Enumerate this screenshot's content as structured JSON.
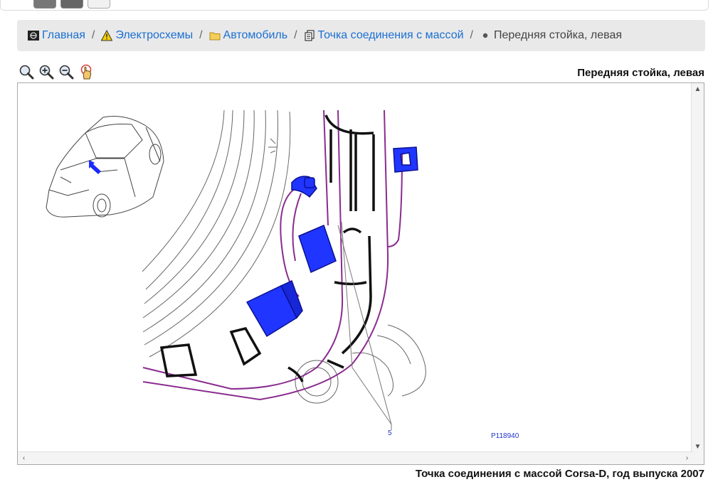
{
  "breadcrumb": {
    "items": [
      {
        "label": "Главная",
        "icon": "car-logo-icon"
      },
      {
        "label": "Электросхемы",
        "icon": "warning-icon"
      },
      {
        "label": "Автомобиль",
        "icon": "folder-icon"
      },
      {
        "label": "Точка соединения с массой",
        "icon": "document-icon"
      },
      {
        "label": "Передняя стойка, левая",
        "icon": "bullet-icon"
      }
    ],
    "separator": "/"
  },
  "toolbar": {
    "icons": [
      "zoom-icon",
      "zoom-in-icon",
      "zoom-out-icon",
      "pan-hand-icon"
    ]
  },
  "viewer": {
    "title": "Передняя стойка, левая",
    "callout_number": "5",
    "figure_id": "P118940"
  },
  "caption": "Точка соединения с массой Corsa-D, год выпуска 2007",
  "colors": {
    "link": "#1a6fd0",
    "connector": "#1a2bff",
    "harness": "#8a2c8f"
  }
}
